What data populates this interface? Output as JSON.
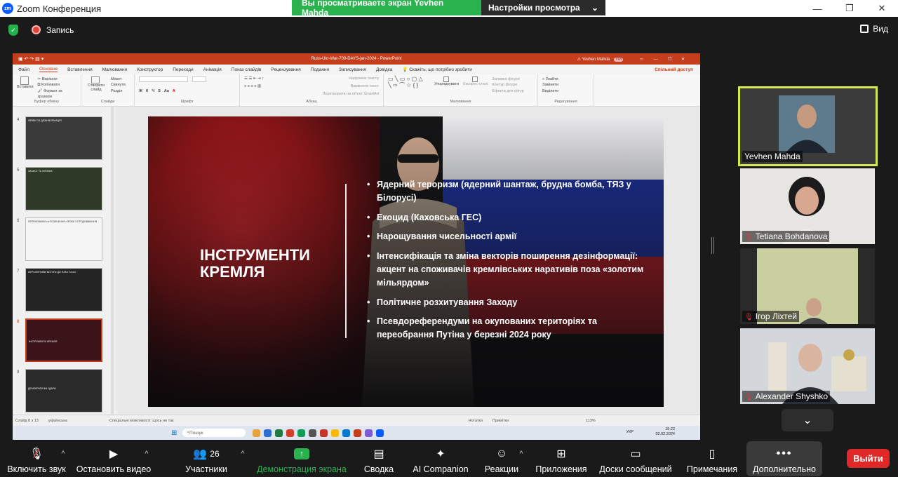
{
  "titlebar": {
    "logo": "zm",
    "app_title": "Zoom Конференция",
    "viewing_banner": "Вы просматриваете экран Yevhen Mahda",
    "view_settings": "Настройки просмотра"
  },
  "top_strip": {
    "record_label": "Запись",
    "view_label": "Вид"
  },
  "powerpoint": {
    "window_title": "Russ-Ukr-War-700-DAYS-jan-2024 - PowerPoint",
    "user_name": "Yevhen Mahda",
    "user_initials": "YM",
    "tabs": [
      "Файл",
      "Основне",
      "Вставлення",
      "Малювання",
      "Конструктор",
      "Переходи",
      "Анімація",
      "Показ слайдів",
      "Рецензування",
      "Подання",
      "Записування",
      "Довідка"
    ],
    "tell_me": "Скажіть, що потрібно зробити",
    "share_button": "Спільний доступ",
    "ribbon_groups": {
      "clipboard": {
        "label": "Буфер обміну",
        "paste": "Вставити",
        "cut": "Вирізати",
        "copy": "Копіювати",
        "format": "Формат за зразком"
      },
      "slides": {
        "label": "Слайди",
        "new_slide": "Створити слайд",
        "layout": "Макет",
        "reset": "Скинути",
        "section": "Розділ"
      },
      "font": {
        "label": "Шрифт"
      },
      "paragraph": {
        "label": "Абзац",
        "text_direction": "Напрямок тексту",
        "align_text": "Вирівняти текст",
        "smartart": "Перетворити на об'єкт SmartArt"
      },
      "drawing": {
        "label": "Малювання",
        "arrange": "Упорядкувати",
        "quick_styles": "Експрес-стилі",
        "fill": "Заливка фігури",
        "outline": "Контур фігури",
        "effects": "Ефекти для фігур"
      },
      "editing": {
        "label": "Редагування",
        "find": "Знайти",
        "replace": "Замінити",
        "select": "Виділити"
      }
    },
    "thumbnails": [
      {
        "num": "4",
        "text": "ФЕЙКИ ТА ДЕЗІНФОРМАЦІЯ"
      },
      {
        "num": "5",
        "text": "ЗАХИСТ ТА УКРАЇНА"
      },
      {
        "num": "6",
        "text": "ПЕРЕМОВИНИ та ПОЗИЧЕННЯ: КРОКИ З ПРОДОВЖЕННЯ"
      },
      {
        "num": "7",
        "text": "ПЕРСПЕКТИВИ ВСТУПУ ДО НАТО ТА ЄС"
      },
      {
        "num": "8",
        "text": "ІНСТРУМЕНТИ КРЕМЛЯ"
      },
      {
        "num": "9",
        "text": "ДЕМОКРАТИЧНІ УДАРИ"
      }
    ],
    "slide": {
      "title": "ІНСТРУМЕНТИ КРЕМЛЯ",
      "bullets": [
        "Ядерний тероризм (ядерний шантаж, брудна бомба, ТЯЗ у Білорусі)",
        "Екоцид (Каховська ГЕС)",
        "Нарощування чисельності армії",
        "Інтенсифікація та зміна векторів поширення дезінформації: акцент на споживачів кремлівських наративів поза «золотим мільярдом»",
        "Політичне розхитування Заходу",
        "Псевдореферендуми на окупованих територіях та переобрання Путіна у березні 2024 року"
      ]
    },
    "status": {
      "slide_of": "Слайд 8 з 13",
      "language": "українська",
      "accessibility": "Спеціальні можливості: щось не так",
      "notes": "Нотатки",
      "comments": "Примітки",
      "zoom": "113%"
    },
    "taskbar": {
      "search": "Пошук",
      "lang": "УКР",
      "time": "15:22",
      "date": "02.02.2024"
    }
  },
  "gallery": [
    {
      "name": "Yevhen Mahda",
      "muted": false,
      "active": true
    },
    {
      "name": "Tetiana Bohdanova",
      "muted": true,
      "active": false
    },
    {
      "name": "Ігор Ліхтей",
      "muted": true,
      "active": false
    },
    {
      "name": "Alexander Shyshko",
      "muted": true,
      "active": false
    }
  ],
  "toolbar": {
    "unmute": "Включить звук",
    "stop_video": "Остановить видео",
    "participants": "Участники",
    "participants_count": "26",
    "share_screen": "Демонстрация экрана",
    "summary": "Сводка",
    "ai_companion": "AI Companion",
    "reactions": "Реакции",
    "apps": "Приложения",
    "whiteboards": "Доски сообщений",
    "notes": "Примечания",
    "more": "Дополнительно",
    "leave": "Выйти"
  },
  "colors": {
    "zoom_blue": "#0b5cff",
    "share_green": "#2ab24f",
    "powerpoint_red": "#c43e1c",
    "active_speaker": "#d4e94d",
    "leave_red": "#e02828"
  }
}
